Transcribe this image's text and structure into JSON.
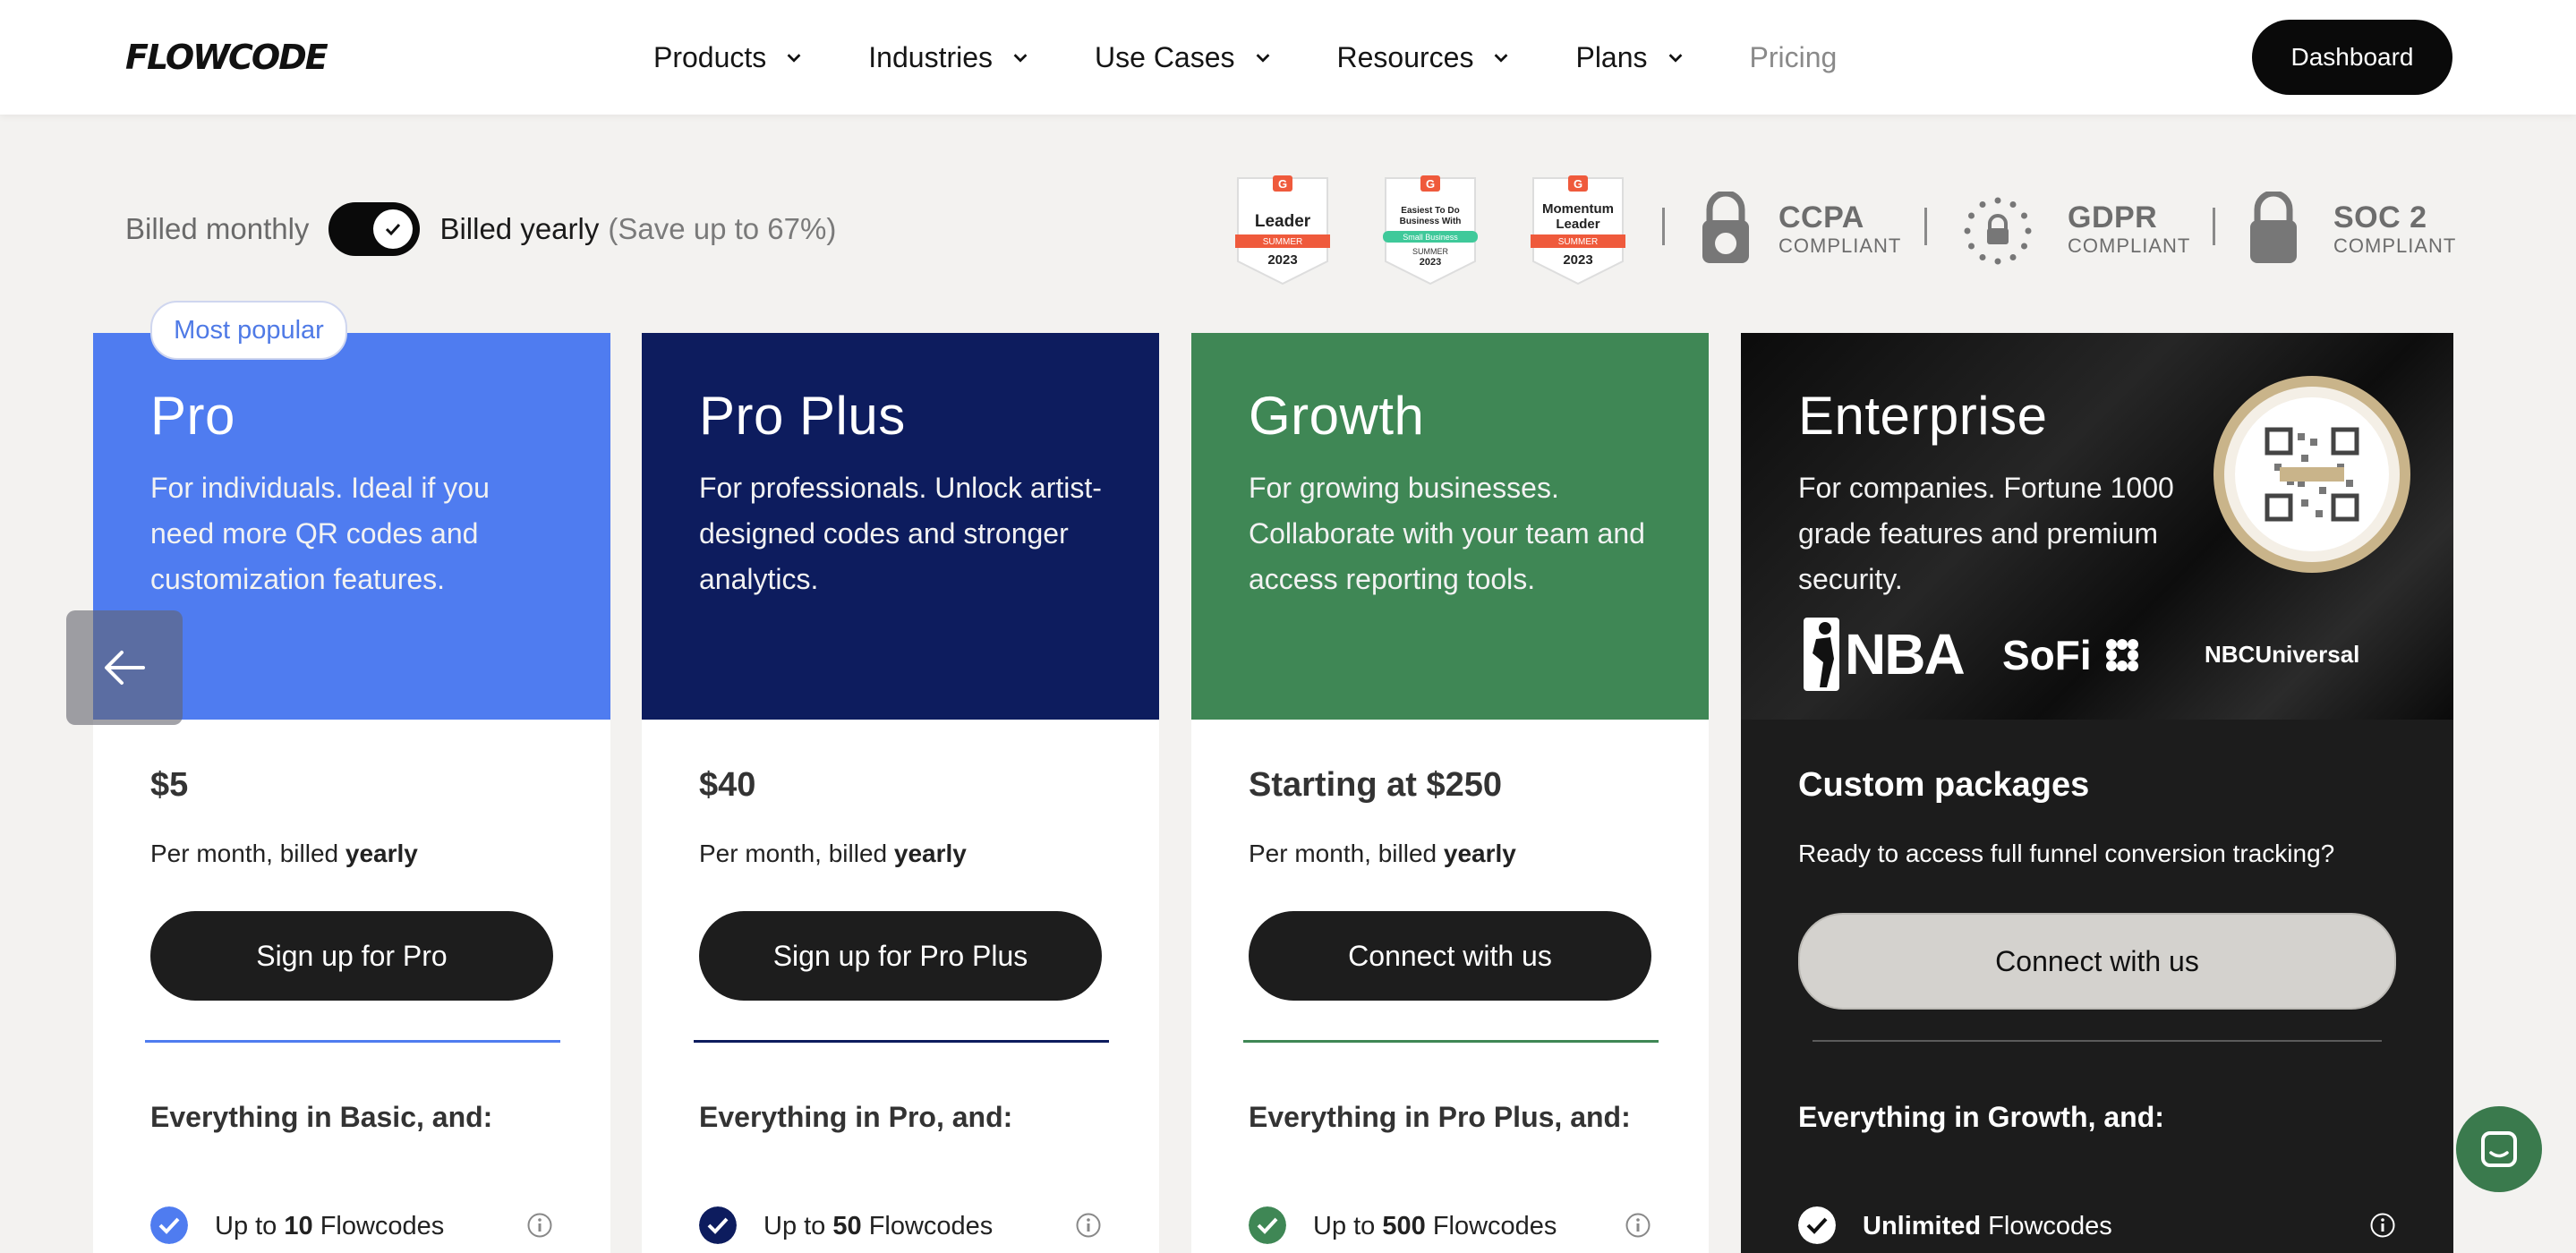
{
  "header": {
    "logo": "FLOWCODE",
    "nav": [
      {
        "label": "Products"
      },
      {
        "label": "Industries"
      },
      {
        "label": "Use Cases"
      },
      {
        "label": "Resources"
      },
      {
        "label": "Plans"
      },
      {
        "label": "Pricing"
      }
    ],
    "dashboard_label": "Dashboard"
  },
  "billing": {
    "monthly_label": "Billed monthly",
    "yearly_label": "Billed yearly",
    "save_note": "(Save up to 67%)",
    "selected": "yearly"
  },
  "badges": [
    {
      "icon": "g2-badge-icon",
      "line1": "Leader",
      "ribbon": "SUMMER",
      "year": "2023",
      "ribbon_color": "#ef5a3c"
    },
    {
      "icon": "g2-badge-icon",
      "line1": "Easiest To Do Business With",
      "ribbon": "Small Business",
      "season": "SUMMER",
      "year": "2023",
      "ribbon_color": "#3fc99a"
    },
    {
      "icon": "g2-badge-icon",
      "line1": "Momentum Leader",
      "ribbon": "SUMMER",
      "year": "2023",
      "ribbon_color": "#ef5a3c"
    }
  ],
  "compliance": [
    {
      "title": "CCPA",
      "sub": "COMPLIANT",
      "icon": "ccpa-lock-icon"
    },
    {
      "title": "GDPR",
      "sub": "COMPLIANT",
      "icon": "gdpr-stars-icon"
    },
    {
      "title": "SOC 2",
      "sub": "COMPLIANT",
      "icon": "soc2-lock-icon"
    }
  ],
  "most_popular": "Most popular",
  "plans": [
    {
      "name": "Pro",
      "description": "For individuals. Ideal if you need more QR codes and customization features.",
      "price": "$5",
      "per": "Per month, billed ",
      "per_bold": "yearly",
      "cta": "Sign up for Pro",
      "everything": "Everything in Basic, and:",
      "feature_pre": "Up to ",
      "feature_bold": "10",
      "feature_post": " Flowcodes",
      "color": "#4f7cf0"
    },
    {
      "name": "Pro Plus",
      "description": "For professionals. Unlock artist-designed codes and stronger analytics.",
      "price": "$40",
      "per": "Per month, billed ",
      "per_bold": "yearly",
      "cta": "Sign up for Pro Plus",
      "everything": "Everything in Pro, and:",
      "feature_pre": "Up to ",
      "feature_bold": "50",
      "feature_post": " Flowcodes",
      "color": "#0d1c5e"
    },
    {
      "name": "Growth",
      "description": "For growing businesses. Collaborate with your team  and access reporting tools.",
      "price": "Starting at $250",
      "per": "Per month, billed ",
      "per_bold": "yearly",
      "cta": "Connect with us",
      "everything": "Everything in Pro Plus, and:",
      "feature_pre": "Up to ",
      "feature_bold": "500",
      "feature_post": " Flowcodes",
      "color": "#3f8755"
    },
    {
      "name": "Enterprise",
      "description": "For companies. Fortune 1000 grade features and premium security.",
      "price": "Custom packages",
      "per_full": "Ready to access full funnel conversion tracking?",
      "cta": "Connect with us",
      "everything": "Everything in Growth, and:",
      "feature_bold": "Unlimited",
      "feature_post": " Flowcodes",
      "logos": [
        "NBA",
        "SoFi",
        "NBCUniversal"
      ],
      "color": "#111111"
    }
  ]
}
